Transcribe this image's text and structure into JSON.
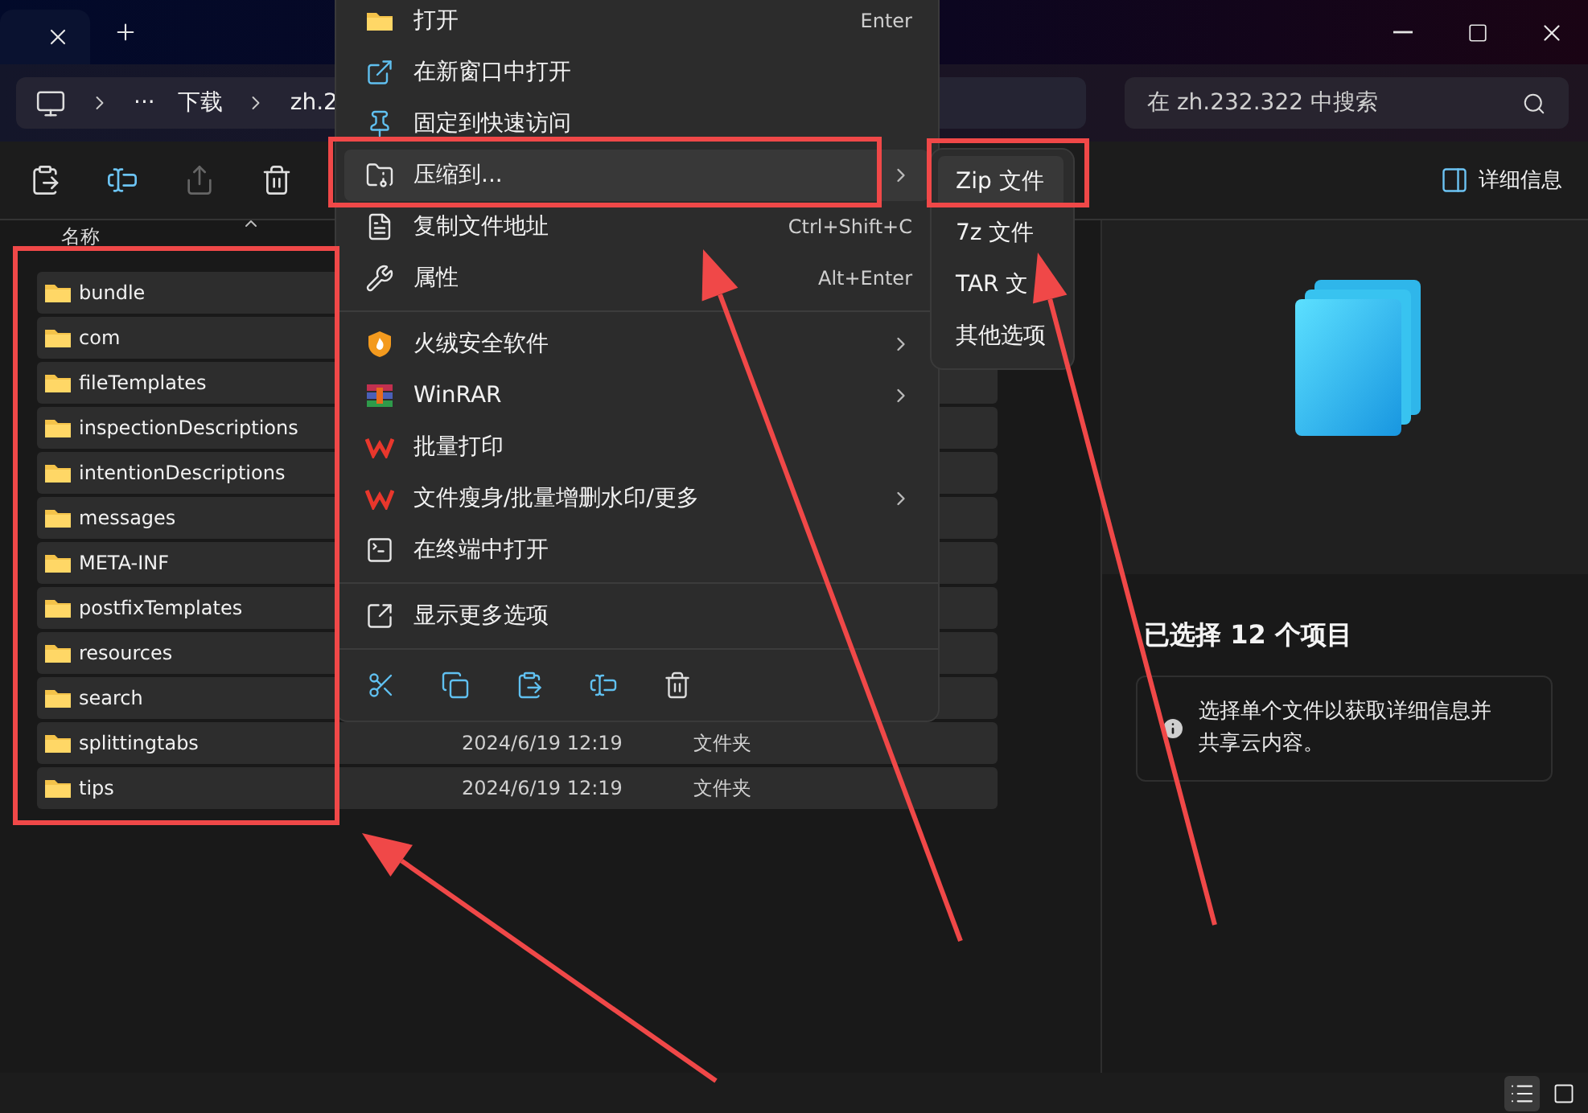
{
  "address_bar": {
    "overflow": "···",
    "path": [
      "下载",
      "zh.2"
    ]
  },
  "search": {
    "placeholder": "在 zh.232.322 中搜索"
  },
  "toolbar": {
    "details_button": "详细信息"
  },
  "file_list": {
    "column": "名称",
    "rows": [
      {
        "name": "bundle",
        "selected": true
      },
      {
        "name": "com",
        "selected": true
      },
      {
        "name": "fileTemplates",
        "selected": true
      },
      {
        "name": "inspectionDescriptions",
        "selected": true
      },
      {
        "name": "intentionDescriptions",
        "selected": true
      },
      {
        "name": "messages",
        "selected": true
      },
      {
        "name": "META-INF",
        "selected": true
      },
      {
        "name": "postfixTemplates",
        "selected": true
      },
      {
        "name": "resources",
        "selected": true
      },
      {
        "name": "search",
        "selected": true
      },
      {
        "name": "splittingtabs",
        "selected": true,
        "modified": "2024/6/19 12:19",
        "type": "文件夹"
      },
      {
        "name": "tips",
        "selected": true,
        "modified": "2024/6/19 12:19",
        "type": "文件夹"
      }
    ]
  },
  "details_pane": {
    "title": "已选择 12 个项目",
    "info": "选择单个文件以获取详细信息并共享云内容。"
  },
  "context_menu": {
    "items": [
      {
        "kind": "item",
        "label": "打开",
        "shortcut": "Enter",
        "submenu": false,
        "selected": false
      },
      {
        "kind": "item",
        "label": "在新窗口中打开",
        "submenu": false,
        "selected": false
      },
      {
        "kind": "item",
        "label": "固定到快速访问",
        "submenu": false,
        "selected": false
      },
      {
        "kind": "item",
        "label": "压缩到...",
        "submenu": true,
        "selected": true
      },
      {
        "kind": "item",
        "label": "复制文件地址",
        "shortcut": "Ctrl+Shift+C",
        "submenu": false,
        "selected": false
      },
      {
        "kind": "item",
        "label": "属性",
        "shortcut": "Alt+Enter",
        "submenu": false,
        "selected": false
      },
      {
        "kind": "divider"
      },
      {
        "kind": "item",
        "label": "火绒安全软件",
        "submenu": true,
        "selected": false
      },
      {
        "kind": "item",
        "label": "WinRAR",
        "submenu": true,
        "selected": false
      },
      {
        "kind": "item",
        "label": "批量打印",
        "submenu": false,
        "selected": false
      },
      {
        "kind": "item",
        "label": "文件瘦身/批量增删水印/更多",
        "submenu": true,
        "selected": false
      },
      {
        "kind": "item",
        "label": "在终端中打开",
        "submenu": false,
        "selected": false
      },
      {
        "kind": "divider"
      },
      {
        "kind": "item",
        "label": "显示更多选项",
        "submenu": false,
        "selected": false
      },
      {
        "kind": "divider"
      }
    ]
  },
  "submenu": {
    "items": [
      {
        "label": "Zip 文件",
        "selected": true
      },
      {
        "label": "7z 文件",
        "selected": false
      },
      {
        "label": "TAR 文",
        "selected": false
      },
      {
        "label": "其他选项",
        "selected": false
      }
    ]
  },
  "status_bar": {
    "view_buttons": [
      {
        "selected": true
      },
      {
        "selected": false
      }
    ]
  }
}
